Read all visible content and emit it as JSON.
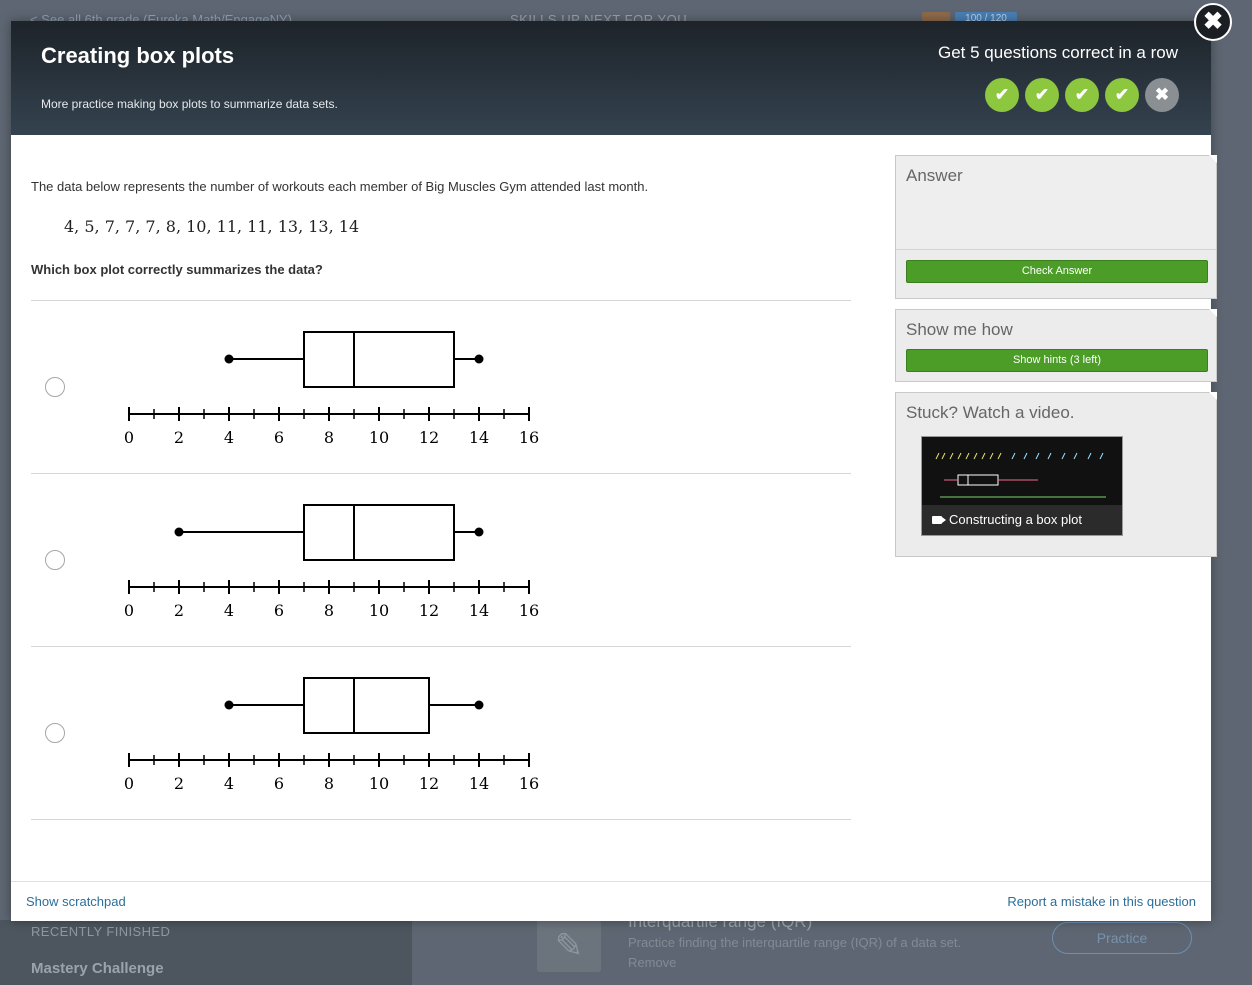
{
  "background": {
    "breadcrumb": "< See all 6th grade (Eureka Math/EngageNY)",
    "center_label": "SKILLS UP NEXT FOR YOU",
    "points_badge": "100 / 120",
    "recently_finished": "RECENTLY FINISHED",
    "mastery_challenge": "Mastery Challenge",
    "topic_title": "Interquartile range (IQR)",
    "topic_desc": "Practice finding the interquartile range (IQR) of a data set.",
    "topic_remove": "Remove",
    "practice_button": "Practice"
  },
  "modal": {
    "title": "Creating box plots",
    "subtitle": "More practice making box plots to summarize data sets.",
    "streak_label": "Get 5 questions correct in a row",
    "streak": [
      {
        "state": "correct",
        "glyph": "✔"
      },
      {
        "state": "correct",
        "glyph": "✔"
      },
      {
        "state": "correct",
        "glyph": "✔"
      },
      {
        "state": "correct",
        "glyph": "✔"
      },
      {
        "state": "incorrect",
        "glyph": "✖"
      }
    ],
    "close_glyph": "✖"
  },
  "question": {
    "text": "The data below represents the number of workouts each member of Big Muscles Gym attended last month.",
    "data": "4, 5, 7, 7, 7, 8, 10, 11, 11, 13, 13, 14",
    "prompt": "Which box plot correctly summarizes the data?"
  },
  "chart_data": [
    {
      "type": "box",
      "axis": {
        "min": 0,
        "max": 16,
        "major_ticks": [
          0,
          2,
          4,
          6,
          8,
          10,
          12,
          14,
          16
        ],
        "minor_step": 1
      },
      "box": {
        "min": 4,
        "q1": 7,
        "median": 9,
        "q3": 13,
        "max": 14
      }
    },
    {
      "type": "box",
      "axis": {
        "min": 0,
        "max": 16,
        "major_ticks": [
          0,
          2,
          4,
          6,
          8,
          10,
          12,
          14,
          16
        ],
        "minor_step": 1
      },
      "box": {
        "min": 2,
        "q1": 7,
        "median": 9,
        "q3": 13,
        "max": 14
      }
    },
    {
      "type": "box",
      "axis": {
        "min": 0,
        "max": 16,
        "major_ticks": [
          0,
          2,
          4,
          6,
          8,
          10,
          12,
          14,
          16
        ],
        "minor_step": 1
      },
      "box": {
        "min": 4,
        "q1": 7,
        "median": 9,
        "q3": 12,
        "max": 14
      }
    }
  ],
  "sidebar": {
    "answer_title": "Answer",
    "check_button": "Check Answer",
    "hints_title": "Show me how",
    "hints_button": "Show hints (3 left)",
    "video_title": "Stuck? Watch a video.",
    "video_caption": "Constructing a box plot"
  },
  "footer": {
    "scratchpad": "Show scratchpad",
    "report": "Report a mistake in this question"
  },
  "colors": {
    "streak_correct": "#8dc63f",
    "streak_missed": "#8a8f94",
    "green_button": "#4b9d28",
    "link": "#2b6f9a"
  }
}
